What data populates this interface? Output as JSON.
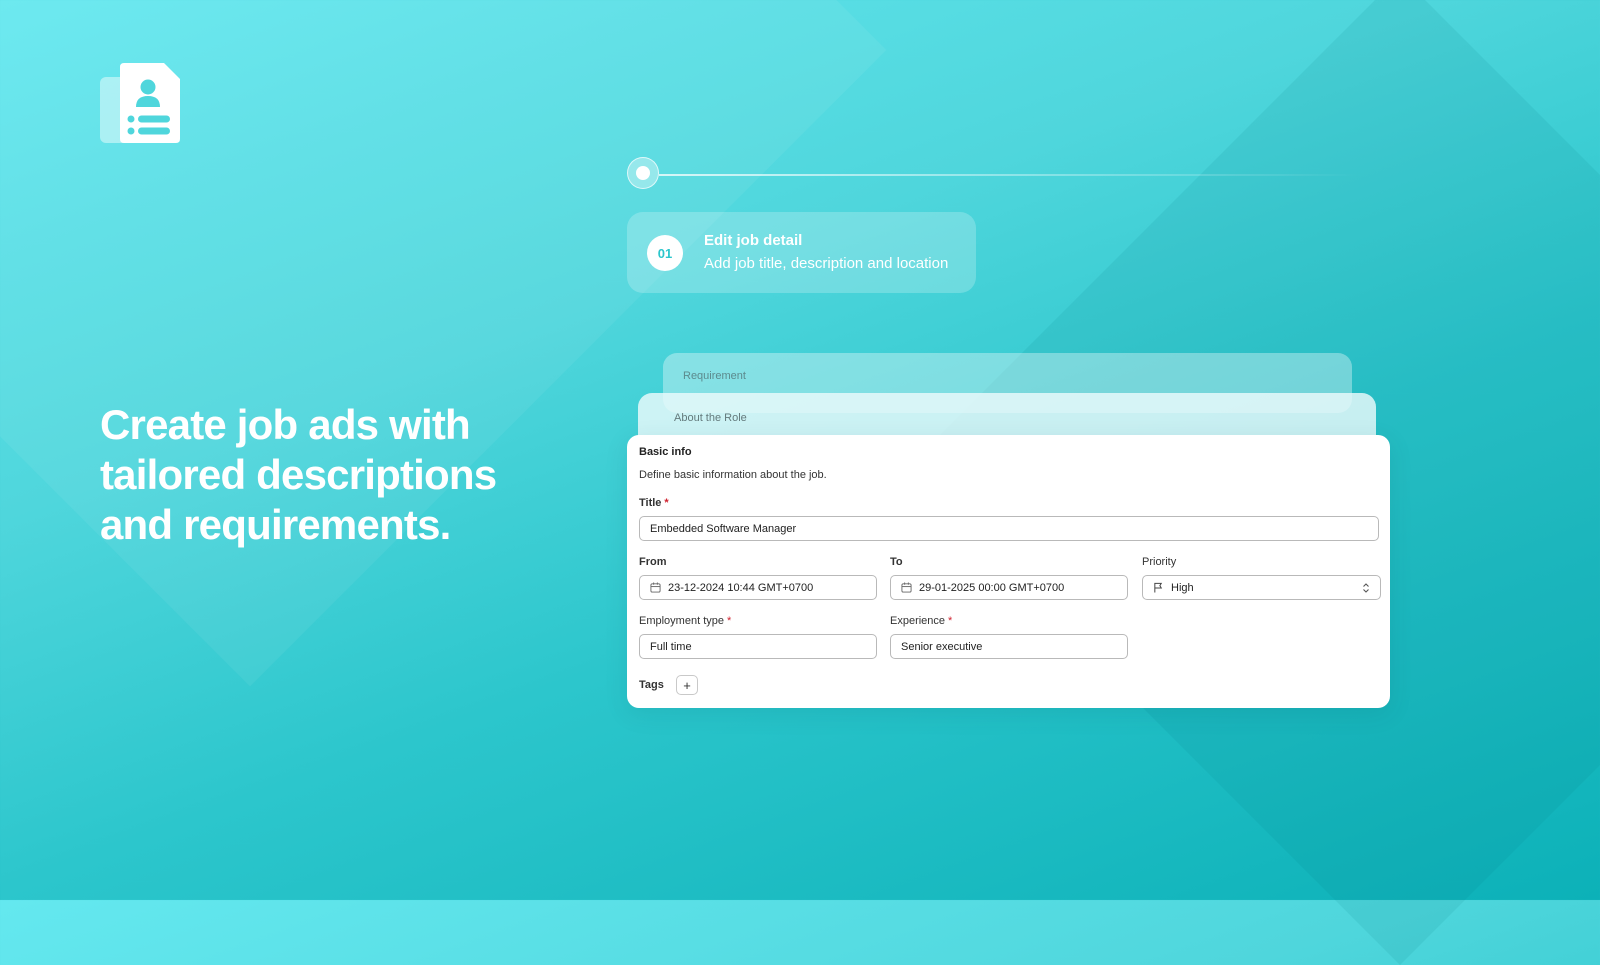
{
  "hero": {
    "headline_line1": "Create job ads with",
    "headline_line2": "tailored descriptions",
    "headline_line3": "and requirements."
  },
  "logo": {
    "icon": "resume-document-icon"
  },
  "stepper": {
    "number": "01",
    "title": "Edit job detail",
    "subtitle": "Add job title, description and location"
  },
  "cards": {
    "back_label": "Requirement",
    "middle_label": "About the Role"
  },
  "form": {
    "heading": "Basic info",
    "description": "Define basic information about the job.",
    "title_label": "Title",
    "title_value": "Embedded Software Manager",
    "from_label": "From",
    "from_value": "23-12-2024 10:44 GMT+0700",
    "to_label": "To",
    "to_value": "29-01-2025 00:00 GMT+0700",
    "priority_label": "Priority",
    "priority_value": "High",
    "employment_label": "Employment type",
    "employment_value": "Full time",
    "experience_label": "Experience",
    "experience_value": "Senior executive",
    "tags_label": "Tags",
    "tags_add": "+",
    "required_mark": "*"
  },
  "colors": {
    "accent": "#2cc6cc",
    "required": "#d0212f",
    "background_start": "#64e8ef",
    "background_end": "#0cb1b8"
  }
}
